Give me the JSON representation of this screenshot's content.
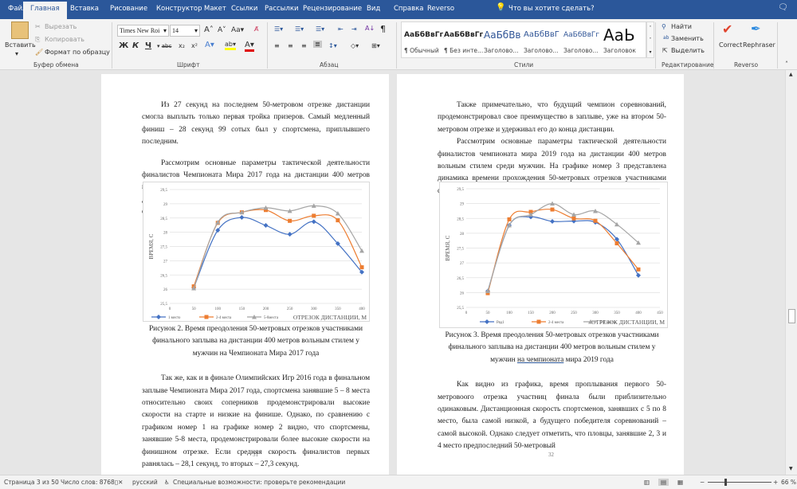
{
  "tabs": [
    "Файл",
    "Главная",
    "Вставка",
    "Рисование",
    "Конструктор",
    "Макет",
    "Ссылки",
    "Рассылки",
    "Рецензирование",
    "Вид",
    "Справка",
    "Reverso"
  ],
  "active_tab": "Главная",
  "tell_me": "Что вы хотите сделать?",
  "clipboard": {
    "paste": "Вставить",
    "cut": "Вырезать",
    "copy": "Копировать",
    "format_painter": "Формат по образцу",
    "label": "Буфер обмена"
  },
  "font": {
    "name": "Times New Roi",
    "size": "14",
    "label": "Шрифт",
    "bold": "Ж",
    "italic": "К",
    "underline": "Ч"
  },
  "paragraph": {
    "label": "Абзац"
  },
  "styles": {
    "label": "Стили",
    "items": [
      {
        "preview": "АаБбВвГг,",
        "name": "¶ Обычный"
      },
      {
        "preview": "АаБбВвГг,",
        "name": "¶ Без инте..."
      },
      {
        "preview": "АаБбВв",
        "name": "Заголово..."
      },
      {
        "preview": "АаБбВвГ",
        "name": "Заголово..."
      },
      {
        "preview": "АаБбВвГг",
        "name": "Заголово..."
      },
      {
        "preview": "АаЬ",
        "name": "Заголовок"
      }
    ]
  },
  "editing": {
    "find": "Найти",
    "replace": "Заменить",
    "select": "Выделить",
    "label": "Редактирование"
  },
  "reverso": {
    "correct": "Correct",
    "rephraser": "Rephraser",
    "label": "Reverso"
  },
  "colors": {
    "brand": "#2b579a",
    "series1": "#4472c4",
    "series2": "#ed7d31",
    "series3": "#a5a5a5"
  },
  "page_left": {
    "p1": "Из 27 секунд на последнем 50-метровом отрезке дистанции смогла выплыть только первая тройка призеров.  Самый медленный финиш – 28 секунд 99 сотых был у спортсмена, приплывшего последним.",
    "p2": "Рассмотрим основные параметры тактической деятельности финалистов Чемпионата Мира 2017 года на дистанции 400 метров вольным стилем среди мужчин. На графике номер 2 представлена динамика времени прохождения 50-метровых отрезков участниками финала.",
    "caption": "Рисунок 2. Время преодоления 50-метровых отрезков участниками финального заплыва на дистанции 400 метров вольным стилем у мужчин на Чемпионата Мира 2017 года",
    "p3": "Так же, как и в финале Олимпийских Игр 2016 года в финальном заплыве Чемпионата Мира 2017 года, спортсмена занявшие 5 – 8 места относительно своих соперников продемонстрировали высокие скорости на старте и низкие на финише. Однако, по сравнению с графиком номер 1 на графике номер 2 видно, что спортсмены, занявшие 5-8 места, продемонстрировали более высокие скорости на финишном отрезке. Если средняя скорость финалистов первых равнялась – 28,1 секунд, то вторых – 27,3 секунд.",
    "page_number": "31"
  },
  "page_right": {
    "p1": "Также примечательно, что будущий чемпион соревнований, продемонстрировал свое преимущество в заплыве, уже на втором 50-метровом отрезке и удерживал его до конца дистанции.",
    "p2": "Рассмотрим основные параметры тактической деятельности финалистов чемпионата мира 2019 года на дистанции 400 метров вольным стилем среди мужчин. На графике номер 3 представлена динамика времени прохождения 50-метровых отрезков участниками финала.",
    "caption_a": "Рисунок 3. Время преодоления 50-метровых отрезков участниками финального заплыва на дистанции 400 метров вольным стилем у мужчин ",
    "caption_u": "на чемпионата",
    "caption_b": " мира 2019 года",
    "p3": "Как видно из графика, время проплывания первого 50-метровоого отрезка участниц финала были приблизительно одинаковым. Дистанционная скорость спортсменов, занявших с 5 по 8 место, была самой низкой, а будущего победителя соревнований – самой высокой. Однако следует отметить, что пловцы, занявшие 2, 3 и 4 место предпоследний 50-метровый",
    "page_number": "32"
  },
  "chart_data": [
    {
      "type": "line",
      "ylabel": "ВРЕМЯ, С",
      "xlabel": "ОТРЕЗОК ДИСТАНЦИИ, М",
      "xlim": [
        0,
        400
      ],
      "ylim": [
        25.5,
        29.5
      ],
      "xticks": [
        "0",
        "50",
        "100",
        "150",
        "200",
        "250",
        "300",
        "350",
        "400"
      ],
      "yticks": [
        "25,5",
        "26",
        "26,5",
        "27",
        "27,5",
        "28",
        "28,5",
        "29",
        "29,5"
      ],
      "x": [
        50,
        100,
        150,
        200,
        250,
        300,
        350,
        400
      ],
      "legend": "bottom-left",
      "grid": "horizontal",
      "series": [
        {
          "name": "1 место",
          "marker": "diamond",
          "values": [
            26.05,
            28.07,
            28.52,
            28.24,
            27.93,
            28.37,
            27.6,
            26.6
          ]
        },
        {
          "name": "2-4 места",
          "marker": "square",
          "values": [
            26.1,
            28.33,
            28.7,
            28.78,
            28.4,
            28.58,
            28.42,
            26.77
          ]
        },
        {
          "name": "5-8места",
          "marker": "triangle",
          "values": [
            26.03,
            28.35,
            28.7,
            28.86,
            28.75,
            28.93,
            28.66,
            27.35
          ]
        }
      ]
    },
    {
      "type": "line",
      "ylabel": "ВРЕМЯ, С",
      "xlabel": "ОТРЕЗОК ДИСТАНЦИИ, М",
      "xlim": [
        0,
        450
      ],
      "ylim": [
        25.5,
        29.5
      ],
      "xticks": [
        "0",
        "50",
        "100",
        "150",
        "200",
        "250",
        "300",
        "350",
        "400",
        "450"
      ],
      "yticks": [
        "25,5",
        "26",
        "26,5",
        "27",
        "27,5",
        "28",
        "28,5",
        "29",
        "29,5"
      ],
      "x": [
        50,
        100,
        150,
        200,
        250,
        300,
        350,
        400
      ],
      "legend": "bottom-center",
      "grid": "horizontal",
      "series": [
        {
          "name": "Ряд1",
          "marker": "diamond",
          "values": [
            26.05,
            28.27,
            28.55,
            28.4,
            28.41,
            28.37,
            27.8,
            26.58
          ]
        },
        {
          "name": "2-4 места",
          "marker": "square",
          "values": [
            25.98,
            28.47,
            28.72,
            28.8,
            28.5,
            28.42,
            27.66,
            26.78
          ]
        },
        {
          "name": "5-8 места",
          "marker": "triangle",
          "values": [
            26.05,
            28.27,
            28.63,
            29.0,
            28.63,
            28.75,
            28.3,
            27.68
          ]
        }
      ]
    }
  ],
  "status": {
    "page": "Страница 3 из 50",
    "words": "Число слов: 8768",
    "language": "русский",
    "accessibility": "Специальные возможности: проверьте рекомендации",
    "zoom": "66 %",
    "zoom_percent": 66
  }
}
